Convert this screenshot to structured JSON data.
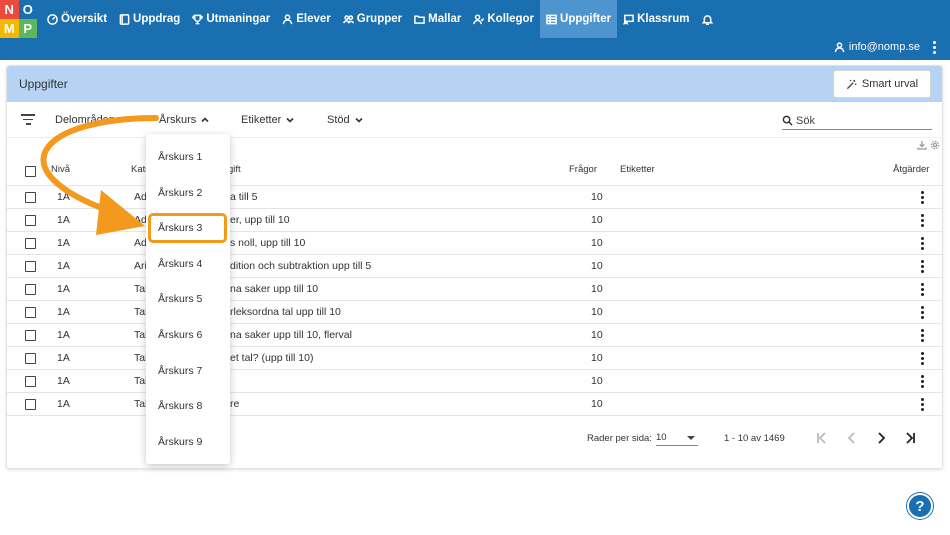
{
  "logo": {
    "letters": [
      "N",
      "O",
      "M",
      "P"
    ],
    "colors": [
      "#e94b3c",
      "#1a6fb0",
      "#f5b800",
      "#5cb85c"
    ]
  },
  "nav": [
    {
      "label": "Översikt",
      "icon": "speedometer-icon"
    },
    {
      "label": "Uppdrag",
      "icon": "book-icon"
    },
    {
      "label": "Utmaningar",
      "icon": "trophy-icon"
    },
    {
      "label": "Elever",
      "icon": "person-icon"
    },
    {
      "label": "Grupper",
      "icon": "people-icon"
    },
    {
      "label": "Mallar",
      "icon": "folder-icon"
    },
    {
      "label": "Kollegor",
      "icon": "colleagues-icon"
    },
    {
      "label": "Uppgifter",
      "icon": "grid-icon",
      "active": true
    },
    {
      "label": "Klassrum",
      "icon": "classroom-icon"
    },
    {
      "label": "",
      "icon": "bell-icon"
    }
  ],
  "user": {
    "email": "info@nomp.se"
  },
  "page": {
    "title": "Uppgifter",
    "smart_button": "Smart urval"
  },
  "filters": {
    "items": [
      "Delområden",
      "Årskurs",
      "Etiketter",
      "Stöd"
    ],
    "search_placeholder": "Sök"
  },
  "table": {
    "headers": {
      "level": "Nivå",
      "category": "Kate",
      "task": "gift",
      "questions": "Frågor",
      "tags": "Etiketter",
      "actions": "Åtgärder"
    },
    "rows": [
      {
        "level": "1A",
        "category": "Ad",
        "task": "a till 5",
        "questions": "10"
      },
      {
        "level": "1A",
        "category": "Ad",
        "task": "er, upp till 10",
        "questions": "10"
      },
      {
        "level": "1A",
        "category": "Ad",
        "task": "s noll, upp till 10",
        "questions": "10"
      },
      {
        "level": "1A",
        "category": "Ari",
        "task": "dition och subtraktion upp till 5",
        "questions": "10"
      },
      {
        "level": "1A",
        "category": "Tal",
        "task": "na saker upp till 10",
        "questions": "10"
      },
      {
        "level": "1A",
        "category": "Tal",
        "task": "rleksordna tal upp till 10",
        "questions": "10"
      },
      {
        "level": "1A",
        "category": "Tal",
        "task": "na saker upp till 10, flerval",
        "questions": "10"
      },
      {
        "level": "1A",
        "category": "Tal",
        "task": "et tal? (upp till 10)",
        "questions": "10"
      },
      {
        "level": "1A",
        "category": "Tal",
        "task": "",
        "questions": "10"
      },
      {
        "level": "1A",
        "category": "Tal",
        "task": "re",
        "questions": "10"
      }
    ]
  },
  "pagination": {
    "rows_per_page_label": "Rader per sida:",
    "rows_per_page": "10",
    "range": "1 - 10 av 1469"
  },
  "dropdown": {
    "options": [
      "Årskurs 1",
      "Årskurs 2",
      "Årskurs 3",
      "Årskurs 4",
      "Årskurs 5",
      "Årskurs 6",
      "Årskurs 7",
      "Årskurs 8",
      "Årskurs 9"
    ],
    "highlighted": "Årskurs 3"
  },
  "colors": {
    "nav_bg": "#1a6fb0",
    "nav_active": "#4e95cf",
    "header_bg": "#b6d3f3",
    "annotation": "#f39a1e"
  },
  "help": {
    "label": "?"
  }
}
